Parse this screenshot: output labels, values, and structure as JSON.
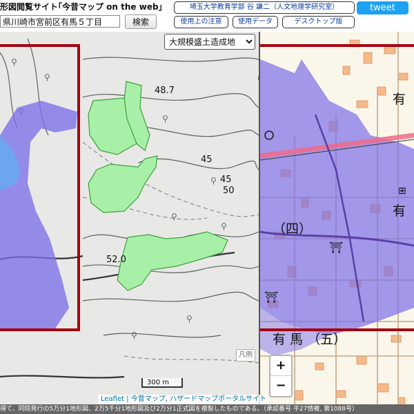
{
  "header": {
    "site_title": "形図閲覧サイト｢今昔マップ on the web｣",
    "address_value": "県川崎市宮前区有馬５丁目",
    "search_label": "検索",
    "author_link": "埼玉大学教育学部 谷 謙二（人文地理学研究室）",
    "notes_link": "使用上の注意",
    "data_link": "使用データ",
    "desktop_link": "デスクトップ版",
    "tweet_label": "tweet"
  },
  "map": {
    "layer_select_value": "大規模盛土造成地",
    "legend_label": "凡例",
    "zoom_in": "+",
    "zoom_out": "−",
    "scale_label": "300 m",
    "attribution": {
      "leaflet": "Leaflet",
      "sep": " | ",
      "konjaku": "今昔マップ",
      "hazard": "ハザードマップポータルサイト"
    },
    "left_labels": {
      "elev_487": "48.7",
      "contour_45a": "45",
      "contour_45b": "45",
      "contour_50": "50",
      "elev_520": "52.0"
    },
    "right_labels": {
      "district_4": "（四）",
      "district_5": "有 馬 （五）",
      "place_a": "有",
      "place_b": "有"
    },
    "colors": {
      "highlight_border": "#a4000f",
      "fill_embankment": "#a8f0a8",
      "fill_hazard": "#7c6fe8",
      "topo_bg": "#e8e8e6",
      "street_bg": "#fbf6ea"
    }
  },
  "footer": {
    "text": "得て、同院発行の5万分1地形図、2万5千分1地形図及び2万分1正式図を複製したものである。（承認番号 平27情複, 第1088号）"
  }
}
